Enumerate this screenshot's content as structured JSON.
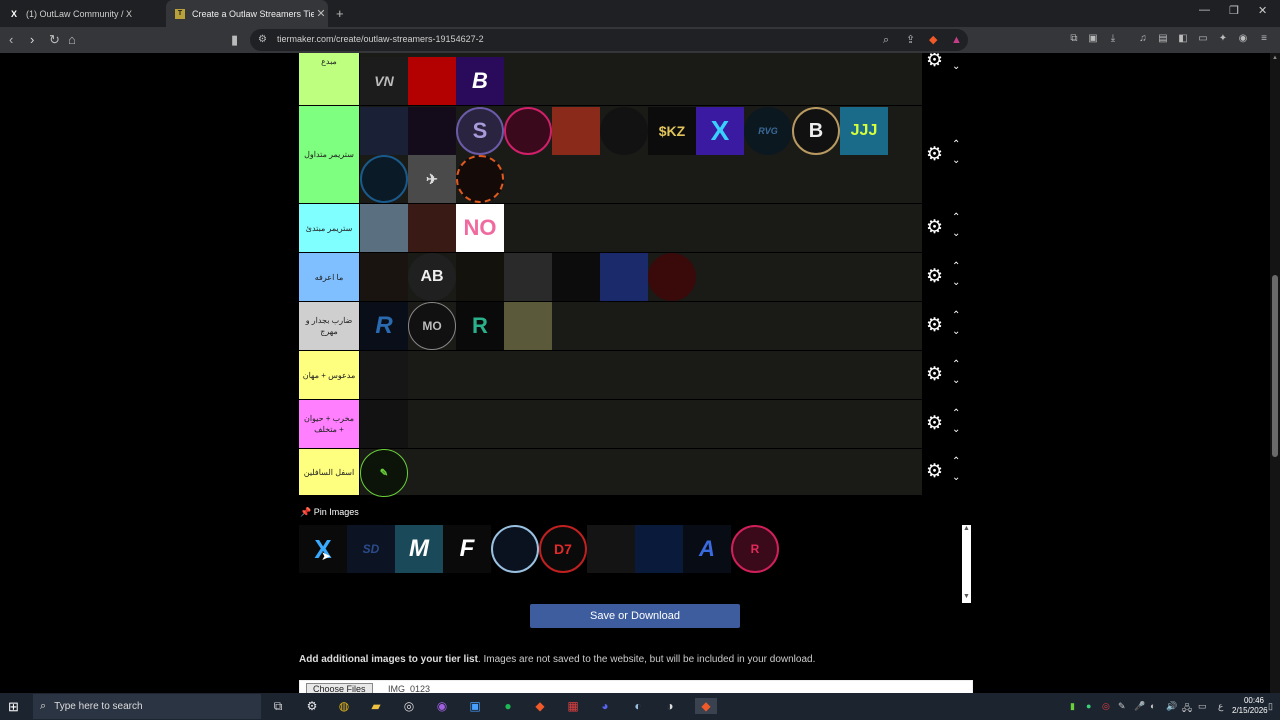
{
  "browser": {
    "tabs": [
      {
        "title": "(1) OutLaw Community / X",
        "icon": "x-logo-icon"
      },
      {
        "title": "Create a Outlaw Streamers Tier L",
        "icon": "tiermaker-icon"
      }
    ],
    "url": "tiermaker.com/create/outlaw-streamers-19154627-2"
  },
  "tiers": [
    {
      "label": "مبدع",
      "color": "#bfff7f"
    },
    {
      "label": "ستريمر متداول",
      "color": "#7fff7f"
    },
    {
      "label": "ستريمر مبتدئ",
      "color": "#7fffff"
    },
    {
      "label": "ما اعرفه",
      "color": "#7fbfff"
    },
    {
      "label": "ضارب بجدار و مهرج",
      "color": "#cfcfcf"
    },
    {
      "label": "مدعوس + مهان",
      "color": "#ffff7f"
    },
    {
      "label": "مخرب + حيوان + متخلف",
      "color": "#ff7fff"
    },
    {
      "label": "اسفل السافلين",
      "color": "#ffff7f"
    }
  ],
  "tier_items": {
    "tier0": [
      "VN",
      "",
      "B"
    ],
    "tier1": [
      "",
      "",
      "S",
      "",
      "",
      "",
      "$KZ",
      "X",
      "RVG",
      "B",
      "JJJ",
      "",
      "",
      ""
    ],
    "tier2": [
      "",
      "",
      "NO"
    ],
    "tier3": [
      "",
      "AB",
      "",
      "",
      "",
      "",
      ""
    ],
    "tier4": [
      "R",
      "MO",
      "R",
      ""
    ],
    "tier5": [
      ""
    ],
    "tier6": [
      ""
    ],
    "tier7": [
      ""
    ]
  },
  "pin": {
    "title": "Pin Images",
    "items": [
      "X",
      "SD",
      "M",
      "F",
      "",
      "D7",
      "",
      "",
      "A",
      "R"
    ]
  },
  "save_label": "Save or Download",
  "add_images": {
    "bold": "Add additional images to your tier list",
    "rest": ". Images are not saved to the website, but will be included in your download.",
    "file_label": "Choose Files",
    "file_value": "IMG_0123"
  },
  "taskbar": {
    "search_placeholder": "Type here to search",
    "time": "00:46",
    "date": "2/15/2026"
  }
}
